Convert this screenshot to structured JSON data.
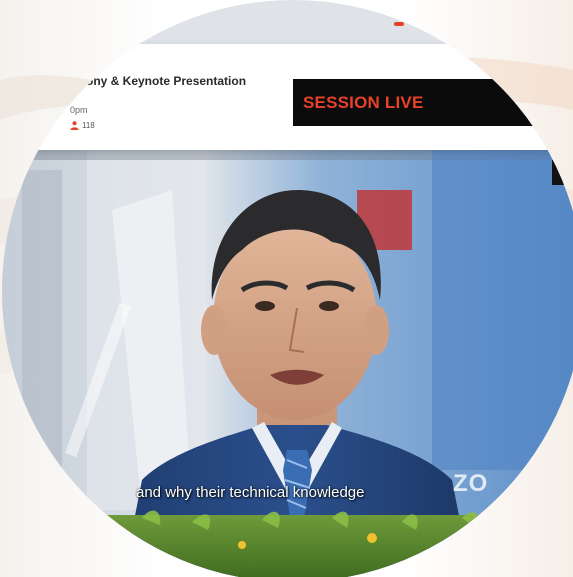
{
  "session": {
    "title": "ony & Keynote Presentation",
    "time": "0pm",
    "attendee_count": "118",
    "live_label": "SESSION LIVE"
  },
  "video": {
    "subtitle": "and why their technical knowledge",
    "watermark": "ZO"
  },
  "colors": {
    "live_text": "#e8412a",
    "live_bg": "#0b0b0b",
    "attendee_icon": "#e8412a"
  },
  "icons": {
    "attendee": "person-icon"
  }
}
